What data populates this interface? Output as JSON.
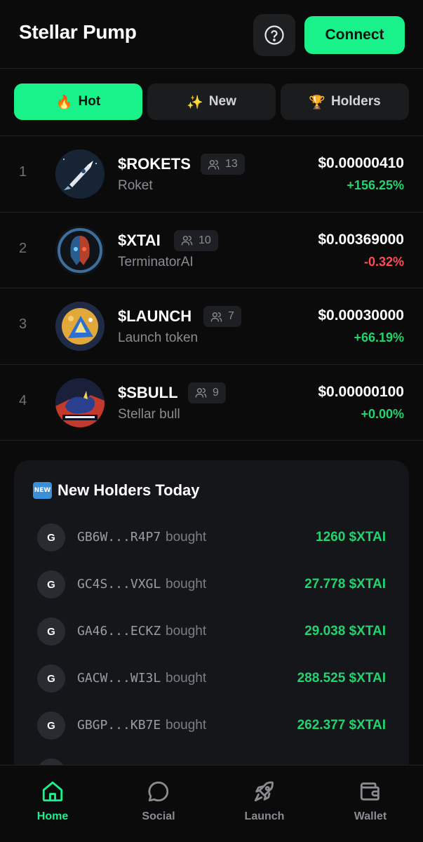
{
  "header": {
    "title": "Stellar Pump",
    "help_icon": "question-circle-icon",
    "connect_label": "Connect"
  },
  "tabs": [
    {
      "emoji": "🔥",
      "label": "Hot",
      "active": true
    },
    {
      "emoji": "✨",
      "label": "New",
      "active": false
    },
    {
      "emoji": "🏆",
      "label": "Holders",
      "active": false
    }
  ],
  "tokens": [
    {
      "rank": "1",
      "ticker": "$ROKETS",
      "holders": "13",
      "name": "Roket",
      "price": "$0.00000410",
      "change": "+156.25%",
      "trend": "up"
    },
    {
      "rank": "2",
      "ticker": "$XTAI",
      "holders": "10",
      "name": "TerminatorAI",
      "price": "$0.00369000",
      "change": "-0.32%",
      "trend": "down"
    },
    {
      "rank": "3",
      "ticker": "$LAUNCH",
      "holders": "7",
      "name": "Launch token",
      "price": "$0.00030000",
      "change": "+66.19%",
      "trend": "up"
    },
    {
      "rank": "4",
      "ticker": "$SBULL",
      "holders": "9",
      "name": "Stellar bull",
      "price": "$0.00000100",
      "change": "+0.00%",
      "trend": "flat"
    }
  ],
  "new_holders": {
    "badge": "NEW",
    "title": "New Holders Today",
    "verb": "bought",
    "items": [
      {
        "initial": "G",
        "address": "GB6W...R4P7",
        "amount": "1260 $XTAI"
      },
      {
        "initial": "G",
        "address": "GC4S...VXGL",
        "amount": "27.778 $XTAI"
      },
      {
        "initial": "G",
        "address": "GA46...ECKZ",
        "amount": "29.038 $XTAI"
      },
      {
        "initial": "G",
        "address": "GACW...WI3L",
        "amount": "288.525 $XTAI"
      },
      {
        "initial": "G",
        "address": "GBGP...KB7E",
        "amount": "262.377 $XTAI"
      }
    ]
  },
  "nav": [
    {
      "label": "Home",
      "icon": "home-icon",
      "active": true
    },
    {
      "label": "Social",
      "icon": "chat-bubble-icon",
      "active": false
    },
    {
      "label": "Launch",
      "icon": "rocket-icon",
      "active": false
    },
    {
      "label": "Wallet",
      "icon": "wallet-icon",
      "active": false
    }
  ],
  "colors": {
    "accent": "#19f28a",
    "positive": "#22d36f",
    "negative": "#ff4a57",
    "background": "#0b0b0c",
    "card": "#15161a"
  }
}
